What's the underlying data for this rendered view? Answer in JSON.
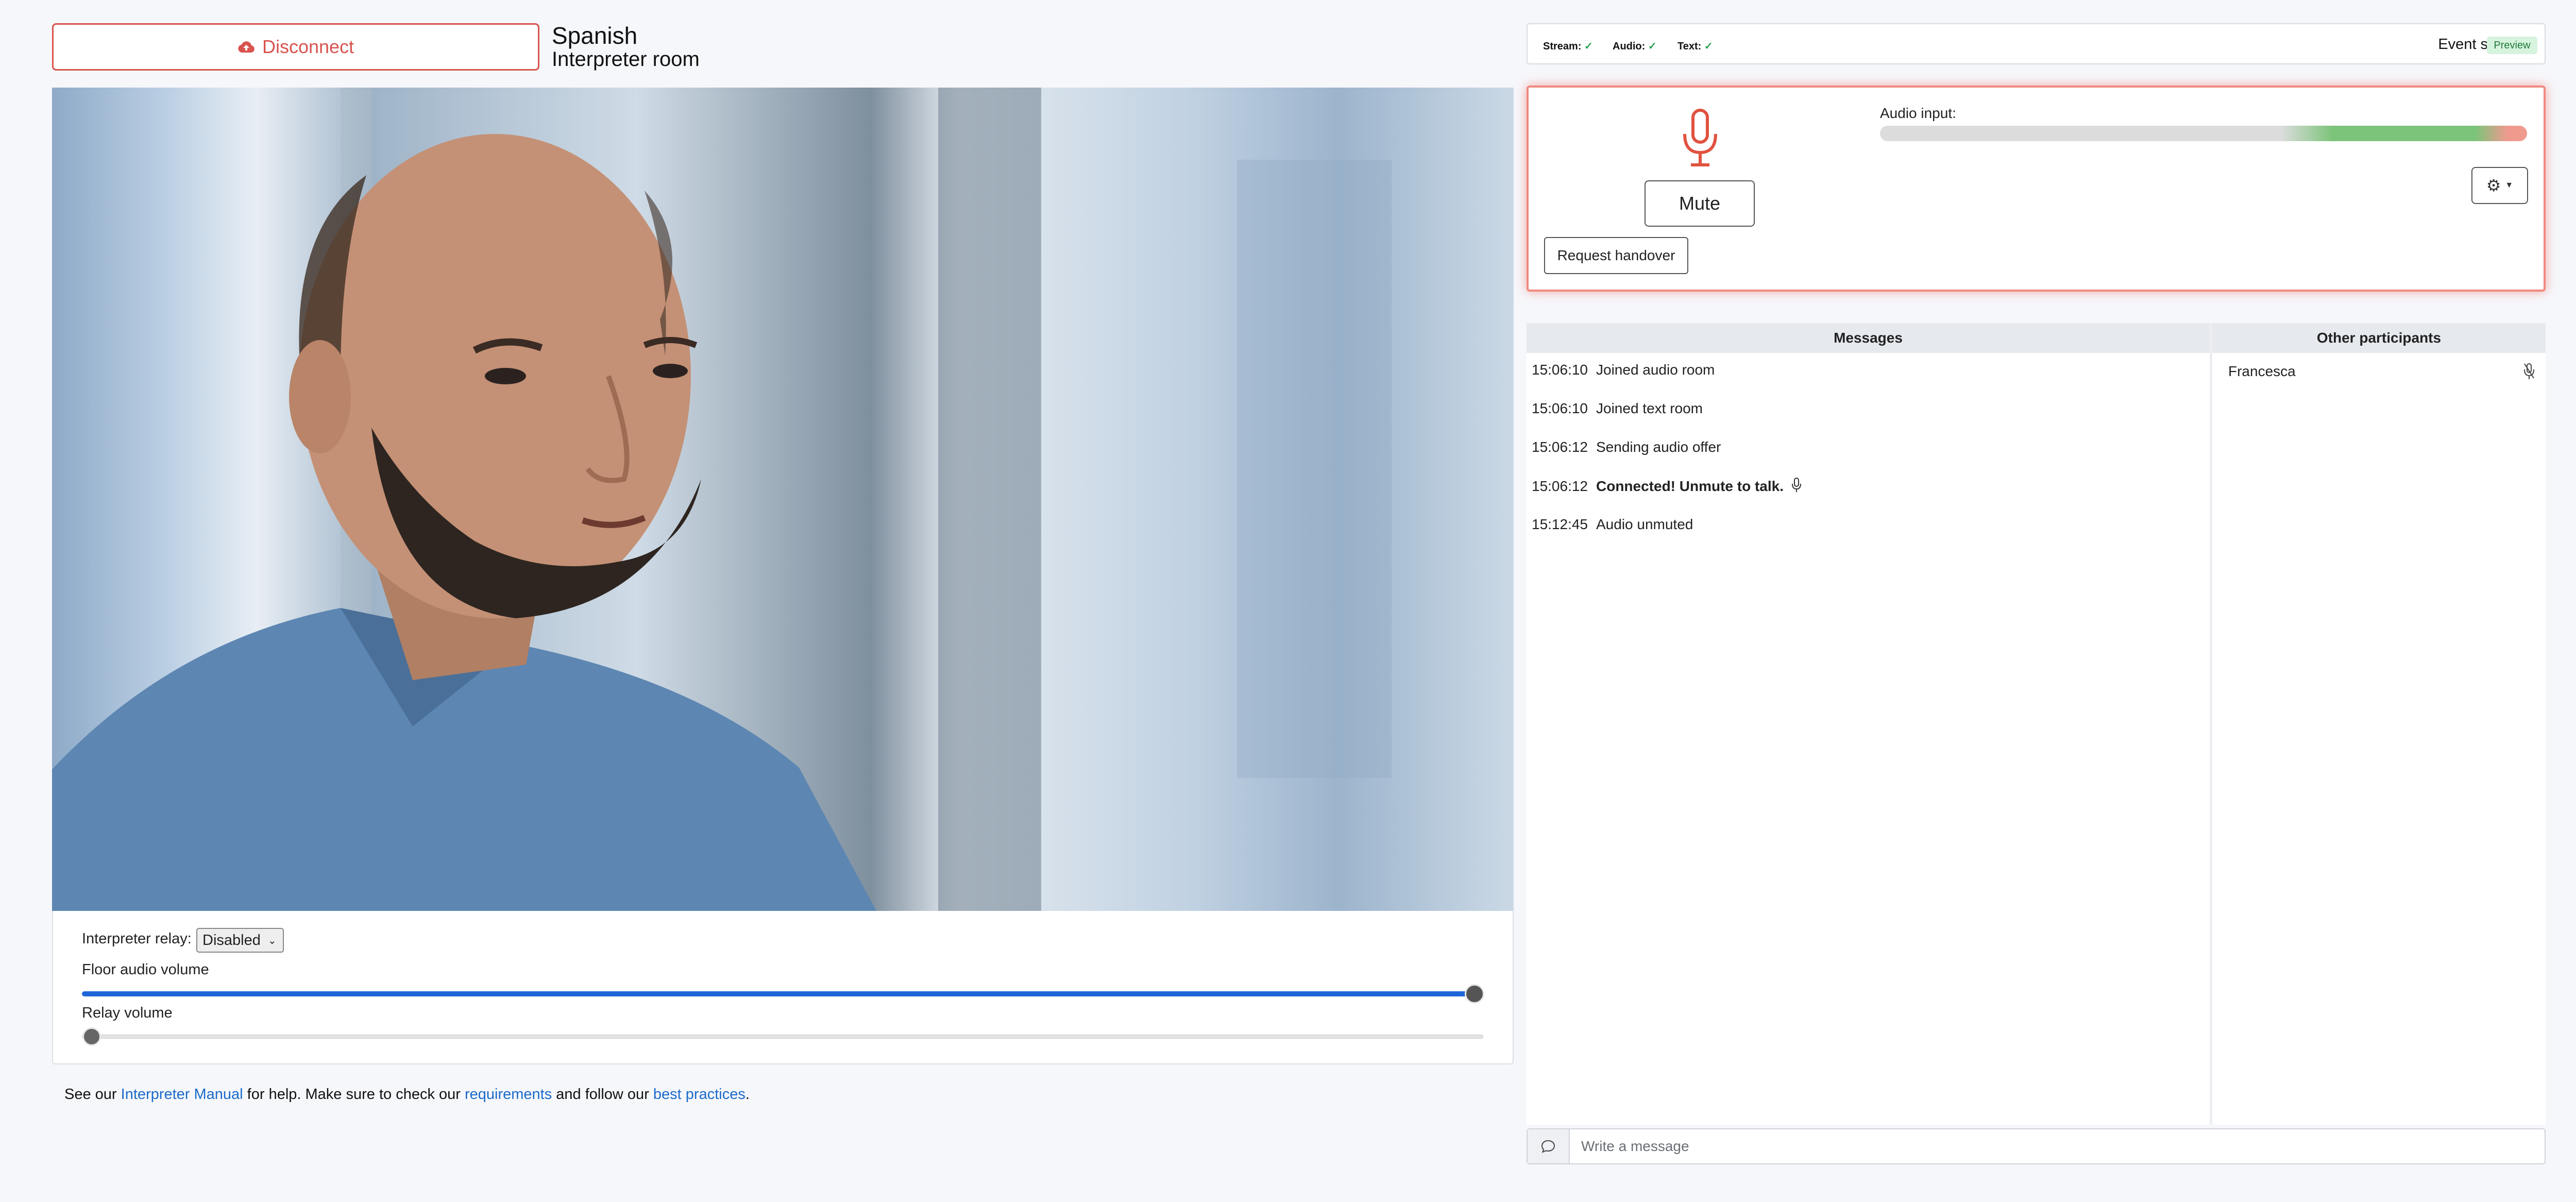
{
  "header": {
    "disconnect_label": "Disconnect",
    "language": "Spanish",
    "room": "Interpreter room"
  },
  "video": {
    "description_icon": "video-feed"
  },
  "controls": {
    "relay_label": "Interpreter relay:",
    "relay_value": "Disabled",
    "floor_volume_label": "Floor audio volume",
    "floor_volume_level": 1.0,
    "relay_volume_label": "Relay volume",
    "relay_volume_level": 0.0
  },
  "footer": {
    "pre": "See our ",
    "manual_link": "Interpreter Manual",
    "mid1": " for help. Make sure to check our ",
    "requirements_link": "requirements",
    "mid2": " and follow our ",
    "practices_link": "best practices",
    "post": "."
  },
  "status": {
    "stream_label": "Stream:",
    "audio_label": "Audio:",
    "text_label": "Text:",
    "check": "✓",
    "event_status_label": "Event status:",
    "event_status_value": "Preview"
  },
  "audio_panel": {
    "mute_label": "Mute",
    "handover_label": "Request handover",
    "audio_input_label": "Audio input:",
    "level": 0.97
  },
  "messages": {
    "title": "Messages",
    "items": [
      {
        "time": "15:06:10",
        "text": "Joined audio room"
      },
      {
        "time": "15:06:10",
        "text": "Joined text room"
      },
      {
        "time": "15:06:12",
        "text": "Sending audio offer"
      },
      {
        "time": "15:06:12",
        "text": "Connected! Unmute to talk."
      },
      {
        "time": "15:12:45",
        "text": "Audio unmuted"
      }
    ]
  },
  "participants": {
    "title": "Other participants",
    "items": [
      {
        "name": "Francesca",
        "muted": true
      }
    ]
  },
  "chat": {
    "placeholder": "Write a message"
  },
  "colors": {
    "danger": "#d9534f",
    "accent": "#1f66d8",
    "ok": "#27a24a"
  }
}
